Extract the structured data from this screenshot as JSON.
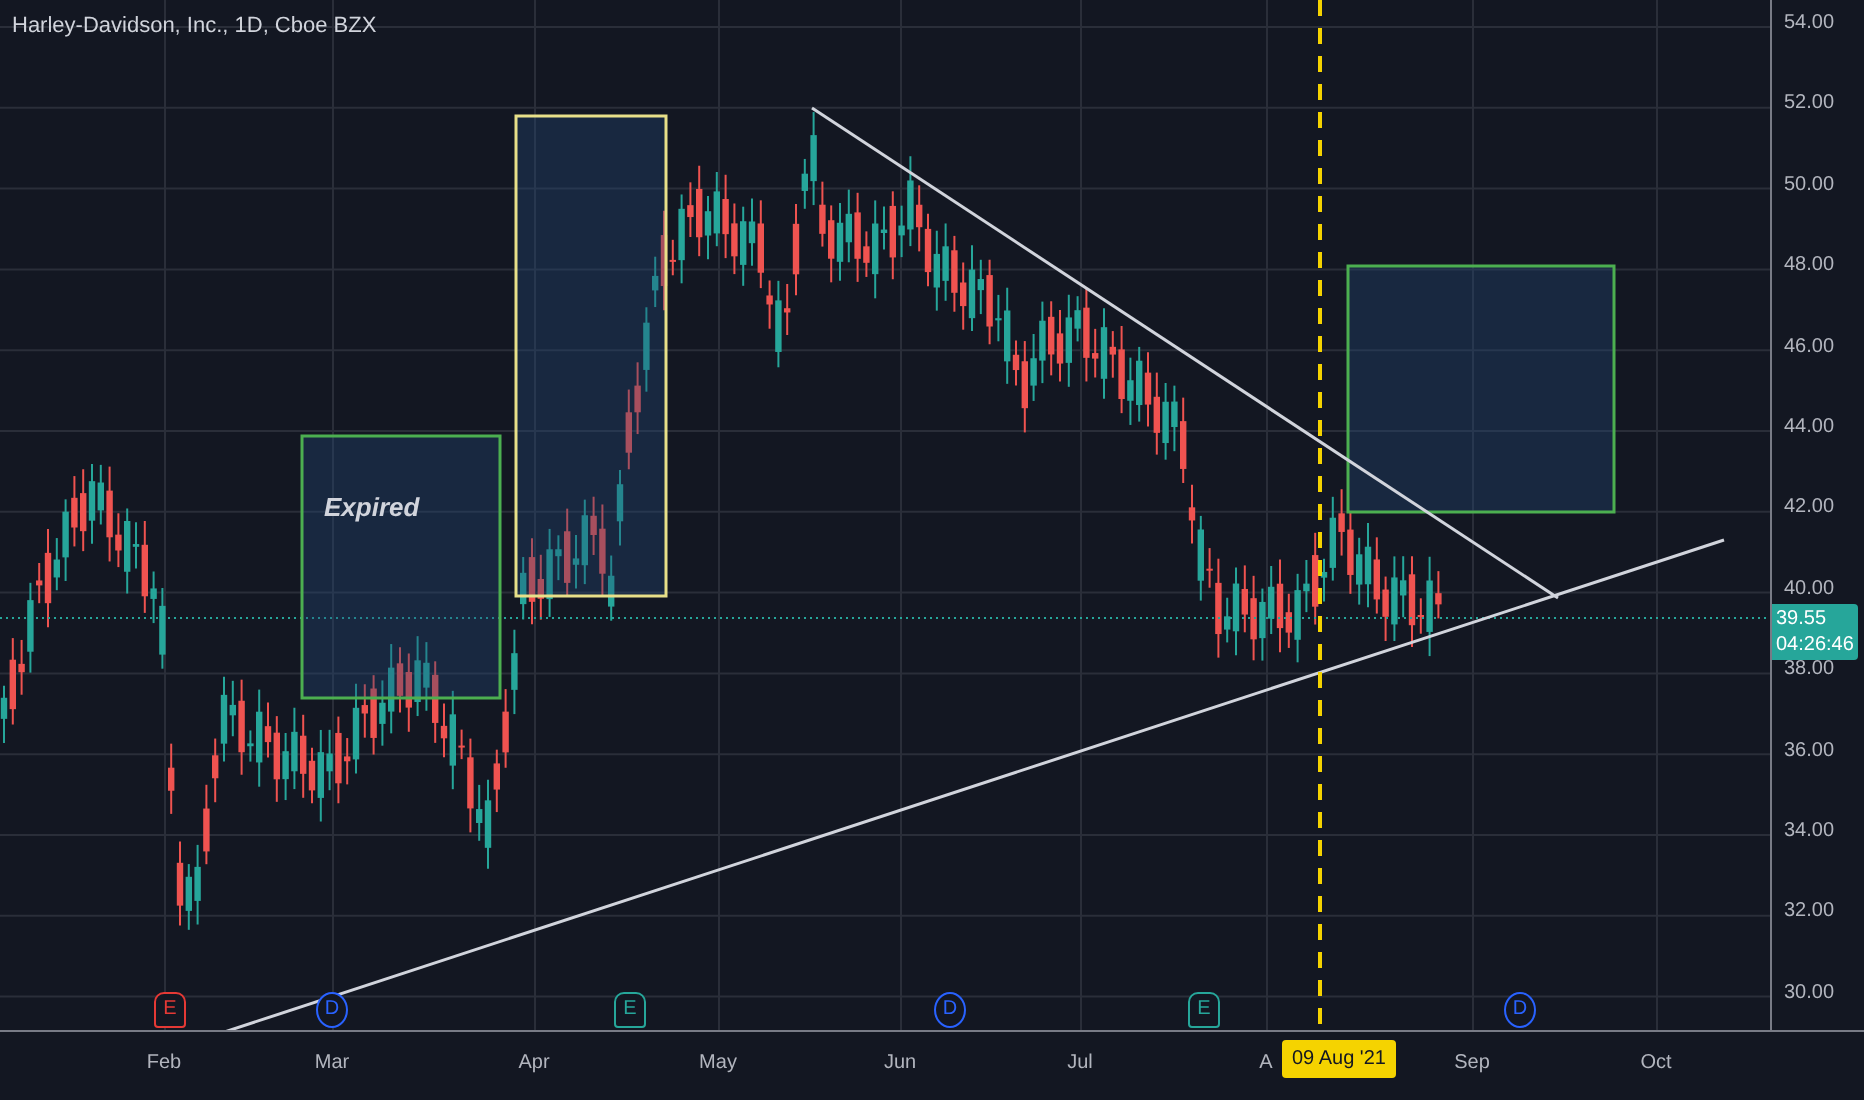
{
  "header": {
    "title": "Harley-Davidson, Inc., 1D, Cboe BZX"
  },
  "price_axis": {
    "ticks": [
      "54.00",
      "52.00",
      "50.00",
      "48.00",
      "46.00",
      "44.00",
      "42.00",
      "40.00",
      "38.00",
      "36.00",
      "34.00",
      "32.00",
      "30.00"
    ],
    "last_price": {
      "price": "39.55",
      "countdown": "04:26:46"
    }
  },
  "time_axis": {
    "labels": [
      "Feb",
      "Mar",
      "Apr",
      "May",
      "Jun",
      "Jul",
      "A",
      "Sep",
      "Oct"
    ],
    "cursor_label": "09 Aug '21"
  },
  "drawings": [
    {
      "kind": "rectangle",
      "color": "#4caf50",
      "label": "Expired"
    },
    {
      "kind": "rectangle",
      "color": "#e8e089"
    },
    {
      "kind": "rectangle",
      "color": "#4caf50"
    },
    {
      "kind": "trendline",
      "color": "#d1d4dc"
    },
    {
      "kind": "trendline",
      "color": "#d1d4dc"
    },
    {
      "kind": "vline",
      "color": "#f5d300"
    }
  ],
  "events": [
    {
      "kind": "earnings",
      "letter": "E",
      "color": "#e53935"
    },
    {
      "kind": "dividend",
      "letter": "D",
      "color": "#2962ff"
    },
    {
      "kind": "earnings",
      "letter": "E",
      "color": "#26a69a"
    },
    {
      "kind": "dividend",
      "letter": "D",
      "color": "#2962ff"
    },
    {
      "kind": "earnings",
      "letter": "E",
      "color": "#26a69a"
    },
    {
      "kind": "dividend",
      "letter": "D",
      "color": "#2962ff"
    }
  ]
}
